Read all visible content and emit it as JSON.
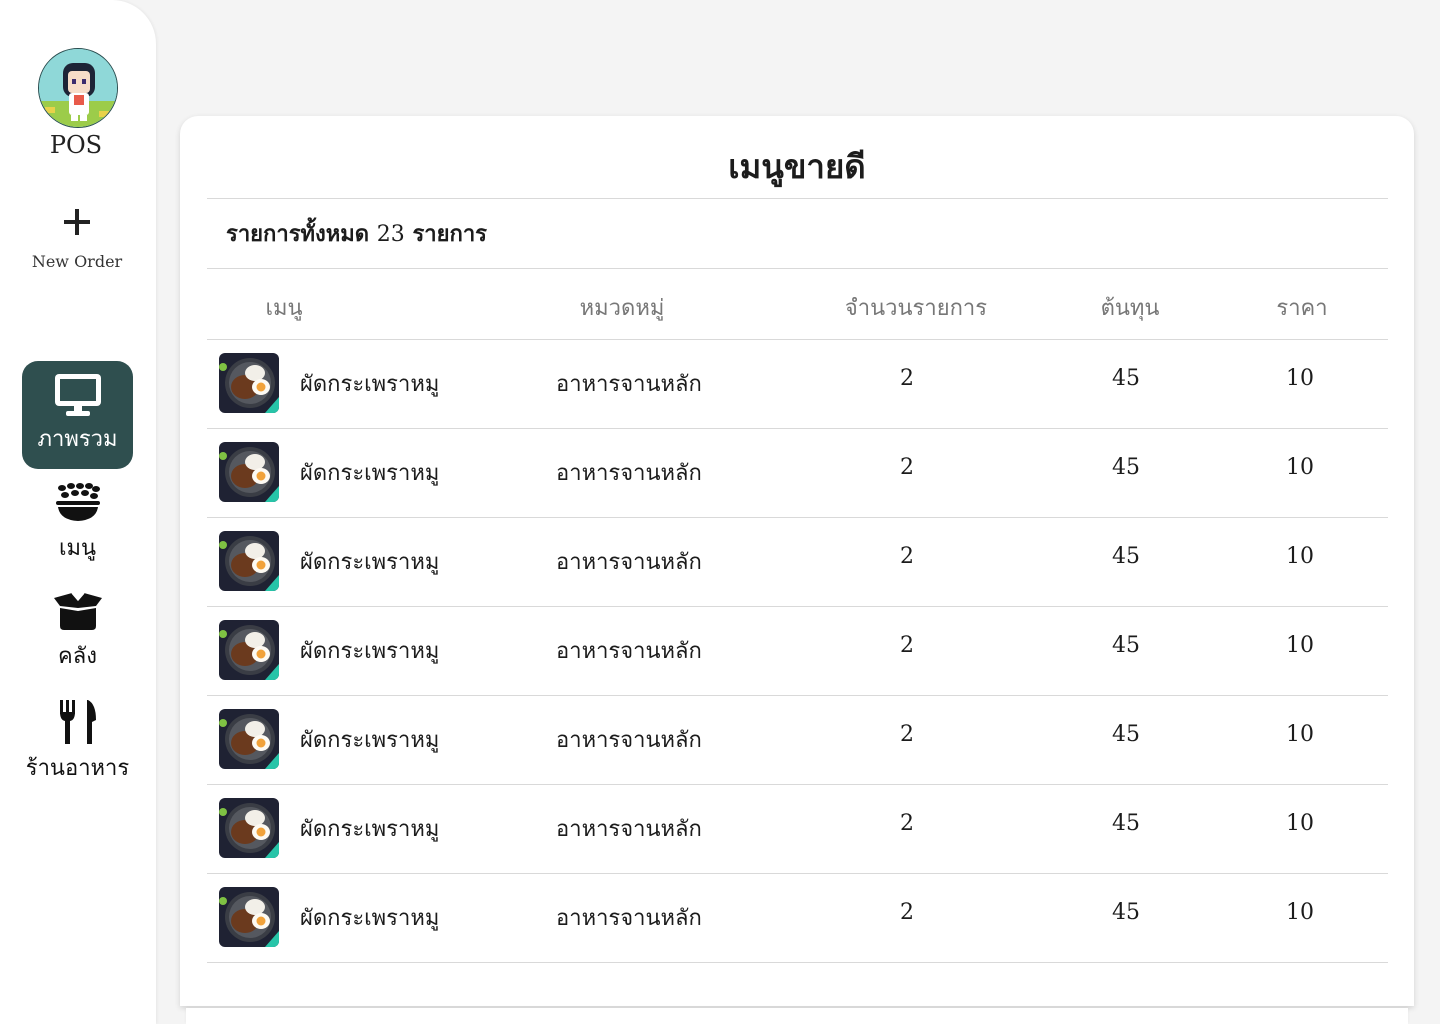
{
  "sidebar": {
    "brand": "POS",
    "new_order_label": "New Order",
    "nav": [
      {
        "label": "ภาพรวม",
        "icon": "monitor-icon",
        "active": true
      },
      {
        "label": "เมนู",
        "icon": "food-bowl-icon",
        "active": false
      },
      {
        "label": "คลัง",
        "icon": "box-icon",
        "active": false
      },
      {
        "label": "ร้านอาหาร",
        "icon": "utensils-icon",
        "active": false
      }
    ]
  },
  "colors": {
    "accent": "#2f4f4f",
    "background": "#f4f4f4",
    "card": "#ffffff"
  },
  "card": {
    "title": "เมนูขายดี",
    "summary_prefix": "รายการทั้งหมด",
    "summary_count": "23",
    "summary_suffix": "รายการ"
  },
  "table": {
    "headers": [
      "เมนู",
      "หมวดหมู่",
      "จำนวนรายการ",
      "ต้นทุน",
      "ราคา"
    ],
    "rows": [
      {
        "name": "ผัดกระเพราหมู",
        "category": "อาหารจานหลัก",
        "qty": "2",
        "cost": "45",
        "price": "10"
      },
      {
        "name": "ผัดกระเพราหมู",
        "category": "อาหารจานหลัก",
        "qty": "2",
        "cost": "45",
        "price": "10"
      },
      {
        "name": "ผัดกระเพราหมู",
        "category": "อาหารจานหลัก",
        "qty": "2",
        "cost": "45",
        "price": "10"
      },
      {
        "name": "ผัดกระเพราหมู",
        "category": "อาหารจานหลัก",
        "qty": "2",
        "cost": "45",
        "price": "10"
      },
      {
        "name": "ผัดกระเพราหมู",
        "category": "อาหารจานหลัก",
        "qty": "2",
        "cost": "45",
        "price": "10"
      },
      {
        "name": "ผัดกระเพราหมู",
        "category": "อาหารจานหลัก",
        "qty": "2",
        "cost": "45",
        "price": "10"
      },
      {
        "name": "ผัดกระเพราหมู",
        "category": "อาหารจานหลัก",
        "qty": "2",
        "cost": "45",
        "price": "10"
      }
    ]
  }
}
